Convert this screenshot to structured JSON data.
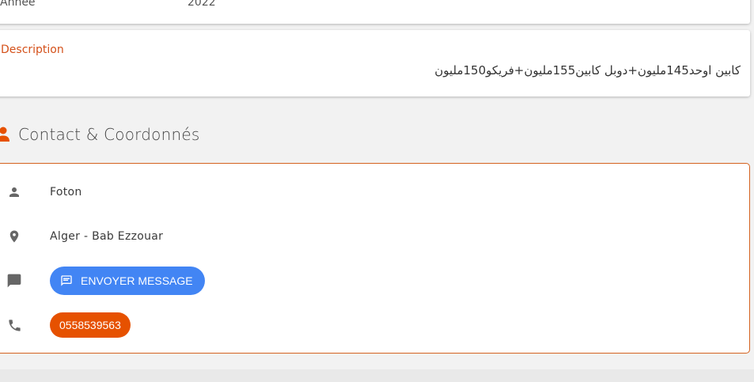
{
  "details": {
    "year_label": "Année",
    "year_value": "2022"
  },
  "description": {
    "label": "Description",
    "text": "كابين اوحد145مليون+دوبل كابين155مليون+فريكو150مليون"
  },
  "contact_section": {
    "title": "Contact & Coordonnés",
    "icon": "person-icon",
    "accent_color": "#e65100",
    "name": "Foton",
    "location": "Alger - Bab Ezzouar",
    "message_button_label": "ENVOYER MESSAGE",
    "phone": "0558539563",
    "icons": {
      "name": "person-icon",
      "location": "location-pin-icon",
      "message": "chat-icon",
      "phone": "phone-icon"
    },
    "colors": {
      "message_button": "#4285f4",
      "phone_button": "#e65100",
      "card_border": "#d4621e",
      "description_label": "#d4511a"
    }
  }
}
